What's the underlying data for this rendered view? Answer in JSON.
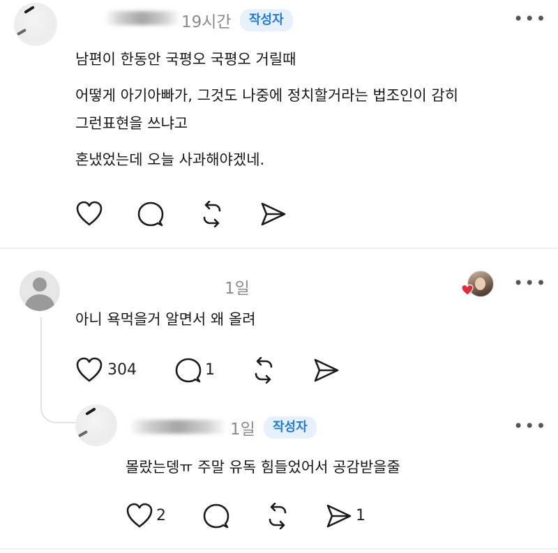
{
  "post": {
    "time": "19시간",
    "badge": "작성자",
    "more": "•••",
    "lines": [
      "남편이 한동안 국평오 국평오 거릴때",
      "어떻게 아기아빠가, 그것도 나중에 정치할거라는 법조인이 감히",
      "그런표현을 쓰냐고",
      "혼냈었는데 오늘 사과해야겠네."
    ],
    "actions": {
      "like": "heart-icon",
      "reply": "comment-icon",
      "repost": "repost-icon",
      "share": "send-icon"
    }
  },
  "comment": {
    "time": "1일",
    "more": "•••",
    "text": "아니 욕먹을거 알면서 왜 올려",
    "likes": "304",
    "replies": "1"
  },
  "reply": {
    "time": "1일",
    "badge": "작성자",
    "more": "•••",
    "text": "몰랐는뎅ㅠ 주말 유독 힘들었어서 공감받을줄",
    "likes": "2",
    "shares": "1"
  },
  "colors": {
    "accent": "#1f7ae0",
    "badge_bg": "#e6f1fc",
    "meta": "#8a8a8a",
    "heart_badge": "#e8283a"
  }
}
